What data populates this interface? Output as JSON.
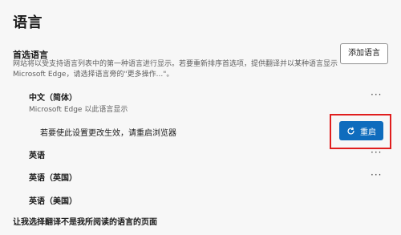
{
  "page": {
    "title": "语言"
  },
  "preferred": {
    "title": "首选语言",
    "description": "网站将以受支持语言列表中的第一种语言进行显示。若要重新排序首选项，提供翻译并以某种语言显示 Microsoft Edge，请选择语言旁的\"更多操作...\"。",
    "add_button": "添加语言"
  },
  "languages": [
    {
      "name": "中文（简体）",
      "subtitle": "Microsoft Edge 以此语言显示"
    },
    {
      "name": "英语"
    },
    {
      "name": "英语（英国）"
    },
    {
      "name": "英语（美国）"
    }
  ],
  "restart": {
    "message": "若要使此设置更改生效，请重启浏览器",
    "button": "重启"
  },
  "more_actions": "···",
  "footer": {
    "title": "让我选择翻译不是我所阅读的语言的页面"
  },
  "colors": {
    "accent": "#0f6cbd",
    "highlight": "#e01e1e"
  }
}
